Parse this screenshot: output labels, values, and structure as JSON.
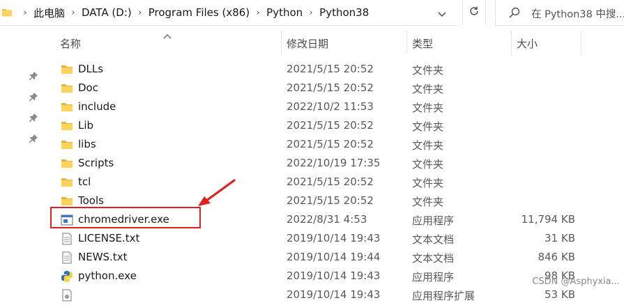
{
  "address": {
    "crumbs": [
      "此电脑",
      "DATA (D:)",
      "Program Files (x86)",
      "Python",
      "Python38"
    ]
  },
  "search": {
    "placeholder": "在 Python38 中搜..."
  },
  "columns": {
    "name": "名称",
    "date": "修改日期",
    "type": "类型",
    "size": "大小"
  },
  "files": [
    {
      "name": "DLLs",
      "date": "2021/5/15 20:52",
      "type": "文件夹",
      "size": "",
      "icon": "folder-icon"
    },
    {
      "name": "Doc",
      "date": "2021/5/15 20:52",
      "type": "文件夹",
      "size": "",
      "icon": "folder-icon"
    },
    {
      "name": "include",
      "date": "2022/10/2 11:53",
      "type": "文件夹",
      "size": "",
      "icon": "folder-icon"
    },
    {
      "name": "Lib",
      "date": "2021/5/15 20:52",
      "type": "文件夹",
      "size": "",
      "icon": "folder-icon"
    },
    {
      "name": "libs",
      "date": "2021/5/15 20:52",
      "type": "文件夹",
      "size": "",
      "icon": "folder-icon"
    },
    {
      "name": "Scripts",
      "date": "2022/10/19 17:35",
      "type": "文件夹",
      "size": "",
      "icon": "folder-icon"
    },
    {
      "name": "tcl",
      "date": "2021/5/15 20:52",
      "type": "文件夹",
      "size": "",
      "icon": "folder-icon"
    },
    {
      "name": "Tools",
      "date": "2021/5/15 20:52",
      "type": "文件夹",
      "size": "",
      "icon": "folder-icon"
    },
    {
      "name": "chromedriver.exe",
      "date": "2022/8/31 4:53",
      "type": "应用程序",
      "size": "11,794 KB",
      "icon": "exe-icon"
    },
    {
      "name": "LICENSE.txt",
      "date": "2019/10/14 19:43",
      "type": "文本文档",
      "size": "31 KB",
      "icon": "text-file-icon"
    },
    {
      "name": "NEWS.txt",
      "date": "2019/10/14 19:44",
      "type": "文本文档",
      "size": "846 KB",
      "icon": "text-file-icon"
    },
    {
      "name": "python.exe",
      "date": "2019/10/14 19:43",
      "type": "应用程序",
      "size": "98 KB",
      "icon": "python-icon"
    },
    {
      "name": "",
      "date": "2019/10/14 19:43",
      "type": "应用程序扩展",
      "size": "53 KB",
      "icon": "dll-icon"
    }
  ],
  "watermark": "CSDN @Asphyxia..."
}
